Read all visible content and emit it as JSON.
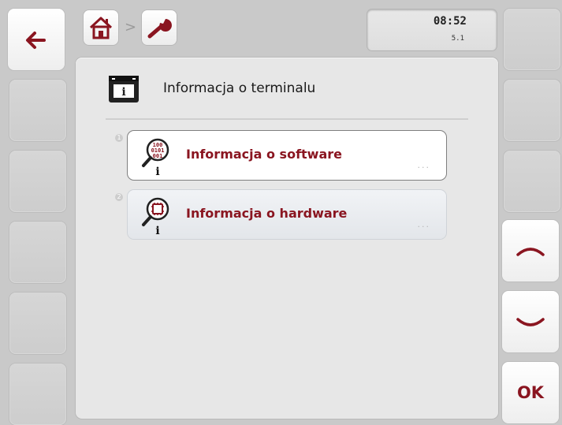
{
  "header": {
    "time": "08:52",
    "version": "5.1",
    "breadcrumb": [
      {
        "icon": "home-icon"
      },
      {
        "separator": ">"
      },
      {
        "icon": "wrench-icon"
      }
    ]
  },
  "panel": {
    "title": "Informacja o terminalu",
    "title_icon": "terminal-info-icon",
    "items": [
      {
        "number": "1",
        "label": "Informacja o software",
        "icon": "software-info-icon",
        "more": "...",
        "selected": true
      },
      {
        "number": "2",
        "label": "Informacja o hardware",
        "icon": "hardware-info-icon",
        "more": "...",
        "selected": false
      }
    ]
  },
  "softkeys": {
    "back_icon": "back-arrow-icon",
    "up_icon": "chevron-up-icon",
    "down_icon": "chevron-down-icon",
    "ok_label": "OK"
  },
  "colors": {
    "accent": "#8a1520",
    "background": "#c9c9c9",
    "panel": "#e7e7e7"
  }
}
